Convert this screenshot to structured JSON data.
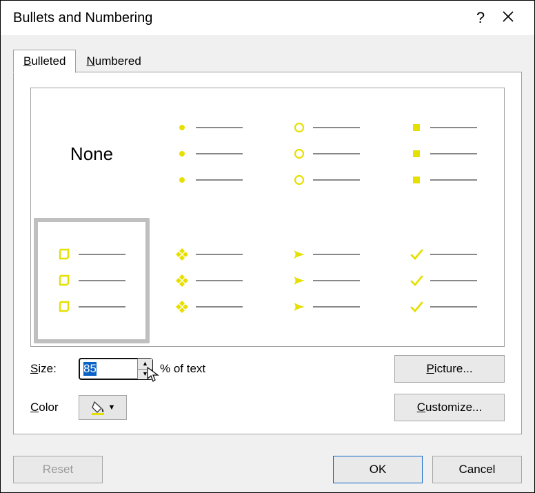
{
  "title": "Bullets and Numbering",
  "tabs": {
    "bulleted": {
      "label_pre": "B",
      "label_post": "ulleted"
    },
    "numbered": {
      "label_pre": "N",
      "label_post": "umbered"
    }
  },
  "gallery": {
    "none_label": "None",
    "styles": [
      "none",
      "filled-circle",
      "hollow-circle",
      "filled-square",
      "hollow-square",
      "four-diamonds",
      "arrowhead",
      "checkmark"
    ],
    "selected_index": 4
  },
  "size": {
    "label_pre": "S",
    "label_post": "ize:",
    "value": "85",
    "suffix": "% of text"
  },
  "color": {
    "label_pre": "C",
    "label_post": "olor",
    "current_hex": "#e6e000"
  },
  "buttons": {
    "picture": {
      "pre": "P",
      "post": "icture..."
    },
    "customize": {
      "pre": "C",
      "post": "ustomize..."
    },
    "reset": {
      "pre": "R",
      "post": "eset"
    },
    "ok": "OK",
    "cancel": "Cancel"
  }
}
